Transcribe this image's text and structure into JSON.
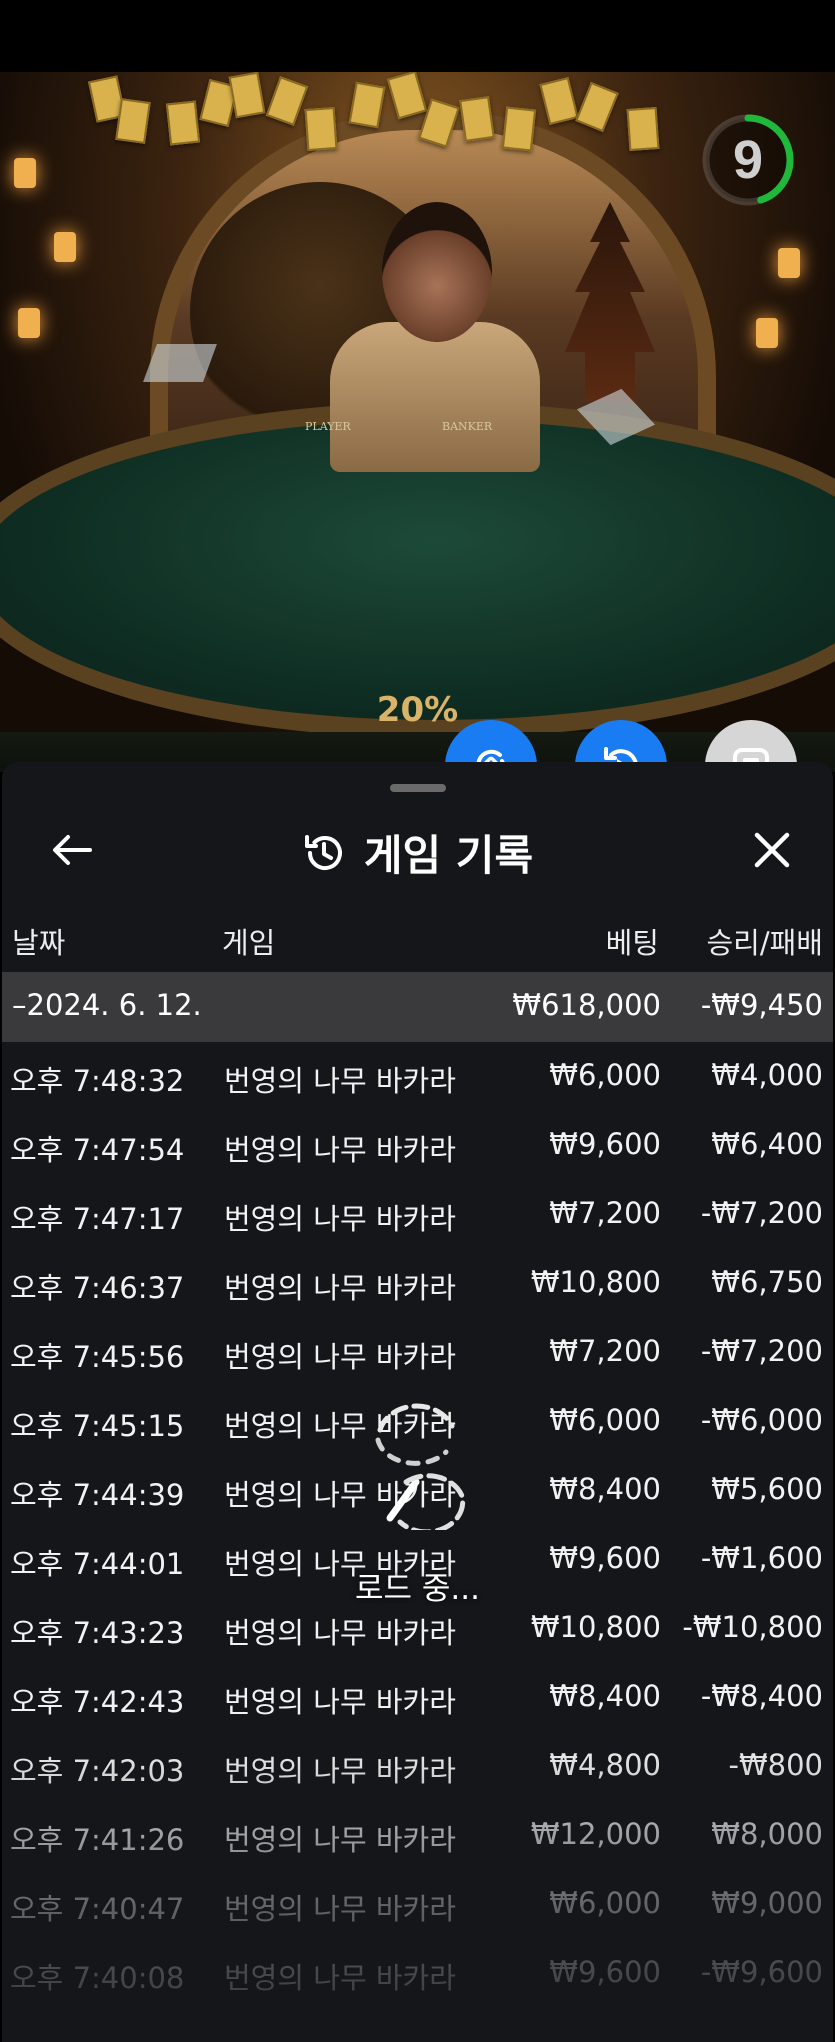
{
  "timer": {
    "value": "9",
    "fraction_remaining": 0.45,
    "color": "#1fb83a"
  },
  "video": {
    "table_player": "PLAYER",
    "table_banker": "BANKER",
    "banner_text": "20%"
  },
  "actions": [
    {
      "name": "switch-view",
      "icon": "swap-icon",
      "color": "#1a7cf2"
    },
    {
      "name": "replay",
      "icon": "replay-icon",
      "color": "#1a7cf2"
    },
    {
      "name": "stop",
      "icon": "stop-icon",
      "color": "#d6d6d6"
    }
  ],
  "panel": {
    "title": "게임 기록",
    "columns": {
      "date": "날짜",
      "game": "게임",
      "bet": "베팅",
      "result": "승리/패배"
    },
    "date_group": {
      "date": "–2024. 6. 12.",
      "bet": "₩618,000",
      "result": "-₩9,450"
    },
    "rows": [
      {
        "time": "오후 7:48:32",
        "game": "번영의 나무 바카라",
        "bet": "₩6,000",
        "result": "₩4,000"
      },
      {
        "time": "오후 7:47:54",
        "game": "번영의 나무 바카라",
        "bet": "₩9,600",
        "result": "₩6,400"
      },
      {
        "time": "오후 7:47:17",
        "game": "번영의 나무 바카라",
        "bet": "₩7,200",
        "result": "-₩7,200"
      },
      {
        "time": "오후 7:46:37",
        "game": "번영의 나무 바카라",
        "bet": "₩10,800",
        "result": "₩6,750"
      },
      {
        "time": "오후 7:45:56",
        "game": "번영의 나무 바카라",
        "bet": "₩7,200",
        "result": "-₩7,200"
      },
      {
        "time": "오후 7:45:15",
        "game": "번영의 나무 바카라",
        "bet": "₩6,000",
        "result": "-₩6,000"
      },
      {
        "time": "오후 7:44:39",
        "game": "번영의 나무 바카라",
        "bet": "₩8,400",
        "result": "₩5,600"
      },
      {
        "time": "오후 7:44:01",
        "game": "번영의 나무 바카라",
        "bet": "₩9,600",
        "result": "-₩1,600"
      },
      {
        "time": "오후 7:43:23",
        "game": "번영의 나무 바카라",
        "bet": "₩10,800",
        "result": "-₩10,800"
      },
      {
        "time": "오후 7:42:43",
        "game": "번영의 나무 바카라",
        "bet": "₩8,400",
        "result": "-₩8,400"
      },
      {
        "time": "오후 7:42:03",
        "game": "번영의 나무 바카라",
        "bet": "₩4,800",
        "result": "-₩800"
      },
      {
        "time": "오후 7:41:26",
        "game": "번영의 나무 바카라",
        "bet": "₩12,000",
        "result": "₩8,000"
      },
      {
        "time": "오후 7:40:47",
        "game": "번영의 나무 바카라",
        "bet": "₩6,000",
        "result": "₩9,000"
      },
      {
        "time": "오후 7:40:08",
        "game": "번영의 나무 바카라",
        "bet": "₩9,600",
        "result": "-₩9,600"
      }
    ]
  },
  "loading": {
    "text": "로드 중..."
  }
}
